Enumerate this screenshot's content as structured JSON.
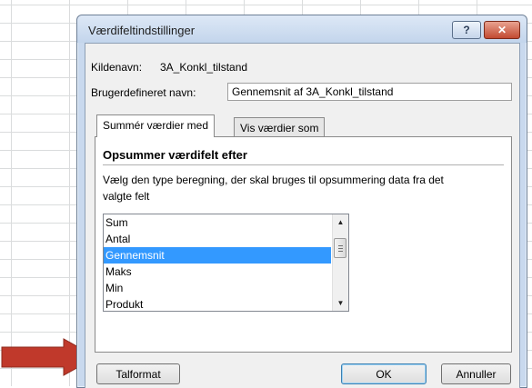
{
  "dialog": {
    "title": "Værdifeltindstillinger",
    "help_label": "?",
    "close_label": "✕",
    "source_label": "Kildenavn:",
    "source_value": "3A_Konkl_tilstand",
    "custom_name_label": "Brugerdefineret navn:",
    "custom_name_value": "Gennemsnit af 3A_Konkl_tilstand",
    "tabs": [
      {
        "label": "Summér værdier med"
      },
      {
        "label": "Vis værdier som"
      }
    ],
    "section_heading": "Opsummer værdifelt efter",
    "description": "Vælg den type beregning, der skal bruges til opsummering data fra det valgte felt",
    "list_items": [
      "Sum",
      "Antal",
      "Gennemsnit",
      "Maks",
      "Min",
      "Produkt"
    ],
    "selected_item": "Gennemsnit",
    "buttons": {
      "number_format": "Talformat",
      "ok": "OK",
      "cancel": "Annuller"
    }
  },
  "colors": {
    "selection": "#3399ff",
    "arrow": "#c0392b",
    "dialog_frame": "#c9d9ee"
  }
}
